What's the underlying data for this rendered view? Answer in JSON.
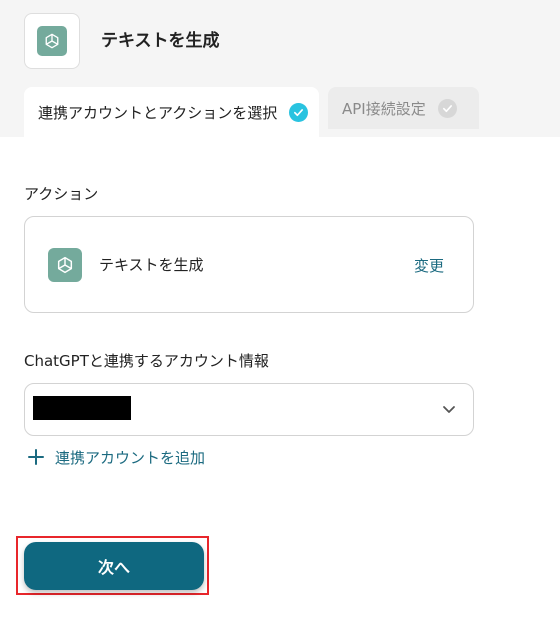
{
  "header": {
    "app_icon": "openai-logo-icon",
    "title": "テキストを生成"
  },
  "tabs": [
    {
      "label": "連携アカウントとアクションを選択",
      "status": "done",
      "icon": "check-circle-icon"
    },
    {
      "label": "API接続設定",
      "status": "pending",
      "icon": "check-circle-icon"
    }
  ],
  "action_section": {
    "label": "アクション",
    "action_name": "テキストを生成",
    "change_label": "変更"
  },
  "account_section": {
    "label": "ChatGPTと連携するアカウント情報",
    "selected_value_redacted": true,
    "add_account_label": "連携アカウントを追加"
  },
  "next_button": {
    "label": "次へ"
  },
  "colors": {
    "accent": "#0f6880",
    "link": "#1b6a80",
    "check_done": "#29c3e0",
    "logo_bg": "#74aa9c",
    "highlight_outline": "#e8262b"
  }
}
